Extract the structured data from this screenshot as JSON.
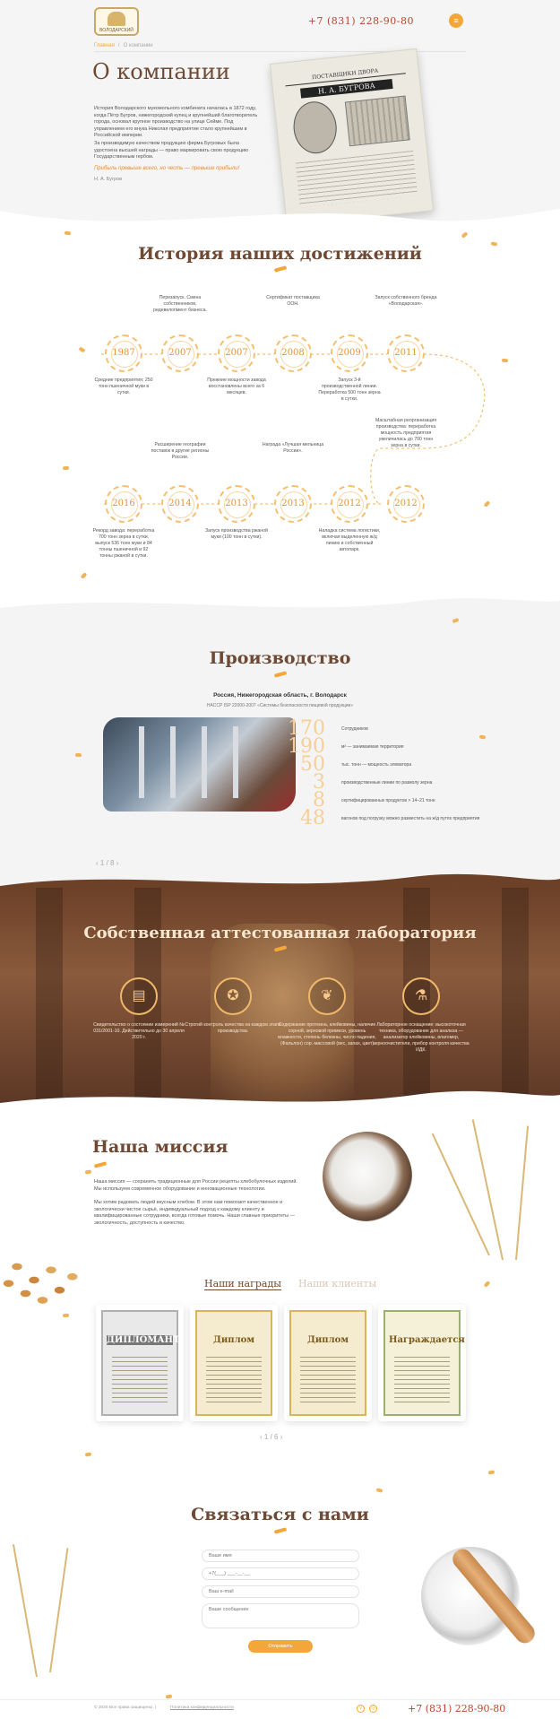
{
  "header": {
    "logo_text": "ВОЛОДАРСКИЙ",
    "phone": "+7 (831) 228-90-80",
    "menu_icon": "hamburger-icon"
  },
  "breadcrumb": {
    "home": "Главная",
    "sep": "/",
    "current": "О компании"
  },
  "about": {
    "title": "О компании",
    "p1": "История Володарского мукомольного комбината началась в 1872 году, когда Пётр Бугров, нижегородский купец и крупнейший благотворитель города, основал крупное производство на улице Сейме. Под управлением его внука Николая предприятие стало крупнейшим в Российской империи.",
    "p2": "За производимую качеством продукцию фирма Бугровых была удостоена высшей награды — право маркировать свою продукцию Государственным гербом.",
    "quote": "Прибыль превыше всего, но честь — превыше прибыли!",
    "author": "Н. А. Бугров",
    "doc_header": "ПОСТАВЩИКИ ДВОРА",
    "doc_name": "Н. А. БУГРОВА"
  },
  "history": {
    "title": "История наших достижений",
    "row1": [
      {
        "year": "1987",
        "text": "Средние предприятия; 250 тонн пшеничной муки в сутки."
      },
      {
        "year": "2007",
        "text": "Перезапуск. Смена собственников, редевелопмент бизнеса."
      },
      {
        "year": "2007",
        "text": "Прежние мощности завода восстановлены всего за 6 месяцев."
      },
      {
        "year": "2008",
        "text": "Сертификат поставщика ООН."
      },
      {
        "year": "2009",
        "text": "Запуск 3-й производственной линии. Переработка 500 тонн зерна в сутки."
      },
      {
        "year": "2011",
        "text": "Запуск собственного бренда «Володарская»."
      }
    ],
    "row2": [
      {
        "year": "2016",
        "text": "Рекорд завода: переработка 700 тонн зерна в сутки, выпуск 536 тонн муки и 84 тонны пшеничной и 92 тонны ржаной в сутки."
      },
      {
        "year": "2014",
        "text": "Расширение географии поставок в другие регионы России."
      },
      {
        "year": "2013",
        "text": "Запуск производства ржаной муки (100 тонн в сутки)."
      },
      {
        "year": "2013",
        "text": "Награда «Лучшая мельница России»."
      },
      {
        "year": "2012",
        "text": "Наладка система логистики, включая выделенную ж/д линию и собственный автопарк."
      },
      {
        "year": "2012",
        "text": "Масштабная реорганизация производства: переработка мощность предприятия увеличилась до 700 тонн зерна в сутки."
      }
    ]
  },
  "production": {
    "title": "Производство",
    "location": "Россия, Нижегородская область, г. Володарск",
    "standard": "HACCP ISP 22000-2007 «Системы безопасности пищевой продукции»",
    "stats": [
      {
        "num": "170",
        "label": "Сотрудников"
      },
      {
        "num": "190",
        "label": "м² — занимаемая территория"
      },
      {
        "num": "50",
        "label": "тыс. тонн — мощность элеватора"
      },
      {
        "num": "3",
        "label": "производственные линии по размолу зерна"
      },
      {
        "num": "8",
        "label": "сертифицированных продуктов > 14–21 тонн"
      },
      {
        "num": "48",
        "label": "вагонов под погрузку можно разместить на ж/д путях предприятия"
      }
    ],
    "pager": "1 / 8"
  },
  "lab": {
    "title": "Собственная аттестованная лаборатория",
    "items": [
      {
        "icon": "certificate-icon",
        "glyph": "▤",
        "text": "Свидетельство о состоянии измерений № 031/2001-10. Действительно до 30 апреля 2020 г."
      },
      {
        "icon": "award-icon",
        "glyph": "✪",
        "text": "Строгий контроль качества на каждом этапе производства."
      },
      {
        "icon": "grain-icon",
        "glyph": "❦",
        "text": "Содержание протеина, клейковины, наличие сорной, зерновой примеси, уровень влажности, степень белизны, число падения, (Фальлон) сор.-массовой (вес, запах, цвет)"
      },
      {
        "icon": "flask-icon",
        "glyph": "⚗",
        "text": "Лабораторное оснащение: высокоточная техника, оборудование для анализа — анализатор клейковины, влагомер, зерноочистители, прибор контроля качества ИДК."
      }
    ]
  },
  "mission": {
    "title": "Наша миссия",
    "p1": "Наша миссия — сохранить традиционные для России рецепты хлебобулочных изделий. Мы используем современное оборудование и инновационные технологии.",
    "p2": "Мы хотим радовать людей вкусным хлебом. В этом нам помогают качественное и экологически чистое сырьё, индивидуальный подход к каждому клиенту и квалифицированные сотрудники, всегда готовые помочь. Наши главные приоритеты — экологичность, доступность и качество."
  },
  "awards": {
    "tab_active": "Наши награды",
    "tab_inactive": "Наши клиенты",
    "items": [
      {
        "title": "ДИПЛОМАНТ"
      },
      {
        "title": "Диплом"
      },
      {
        "title": "Диплом"
      },
      {
        "title": "Награждается"
      }
    ],
    "pager": "1 / 6"
  },
  "contact": {
    "title": "Связаться с нами",
    "name_placeholder": "Ваше имя",
    "phone_placeholder": "+7(___) ___-__-__",
    "email_placeholder": "Ваш e-mail",
    "message_placeholder": "Ваше сообщение",
    "send_label": "Отправить"
  },
  "footer": {
    "copyright": "© 2020 Все права защищены",
    "sep": "|",
    "policy": "Политика конфиденциальности",
    "phone": "+7 (831) 228-90-80",
    "social": [
      "vk-icon",
      "instagram-icon"
    ]
  },
  "colors": {
    "accent": "#f3a73a",
    "title": "#6e4a34",
    "phone": "#b7452f",
    "lab_bg": "#6c4128"
  }
}
